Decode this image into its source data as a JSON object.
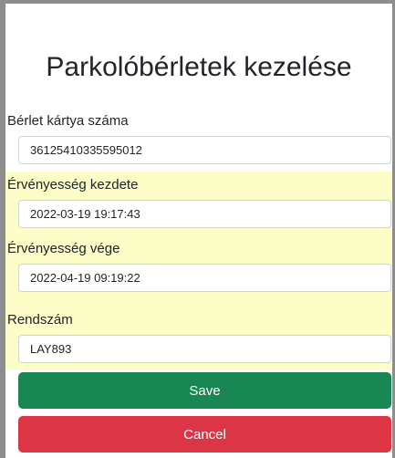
{
  "page": {
    "title": "Parkolóbérletek kezelése"
  },
  "form": {
    "card_number": {
      "label": "Bérlet kártya száma",
      "value": "36125410335595012"
    },
    "valid_from": {
      "label": "Érvényesség kezdete",
      "value": "2022-03-19 19:17:43"
    },
    "valid_to": {
      "label": "Érvényesség vége",
      "value": "2022-04-19 09:19:22"
    },
    "plate": {
      "label": "Rendszám",
      "value": "LAY893"
    }
  },
  "actions": {
    "save_label": "Save",
    "cancel_label": "Cancel"
  },
  "colors": {
    "highlight_bg": "#fdfdc8",
    "save_bg": "#198754",
    "cancel_bg": "#dc3545",
    "frame": "#8d8d8d"
  }
}
